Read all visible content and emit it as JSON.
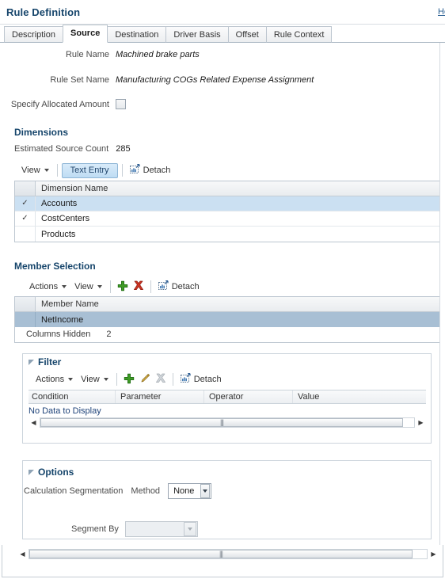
{
  "header": {
    "title": "Rule Definition",
    "help_link": "Help"
  },
  "tabs": [
    {
      "label": "Description",
      "active": false
    },
    {
      "label": "Source",
      "active": true
    },
    {
      "label": "Destination",
      "active": false
    },
    {
      "label": "Driver Basis",
      "active": false
    },
    {
      "label": "Offset",
      "active": false
    },
    {
      "label": "Rule Context",
      "active": false
    }
  ],
  "form": {
    "rule_name_label": "Rule Name",
    "rule_name_value": "Machined brake parts",
    "rule_set_name_label": "Rule Set Name",
    "rule_set_name_value": "Manufacturing COGs Related Expense Assignment",
    "specify_allocated_amount_label": "Specify Allocated Amount",
    "specify_allocated_amount_checked": false
  },
  "dimensions": {
    "section_title": "Dimensions",
    "estimated_source_count_label": "Estimated Source Count",
    "estimated_source_count_value": "285",
    "toolbar": {
      "view_label": "View",
      "text_entry_label": "Text Entry",
      "detach_label": "Detach"
    },
    "columns": [
      "Dimension Name"
    ],
    "rows": [
      {
        "checked": true,
        "name": "Accounts",
        "selected": "light"
      },
      {
        "checked": true,
        "name": "CostCenters",
        "selected": "none"
      },
      {
        "checked": false,
        "name": "Products",
        "selected": "none"
      }
    ]
  },
  "member_selection": {
    "section_title": "Member Selection",
    "toolbar": {
      "actions_label": "Actions",
      "view_label": "View",
      "add_icon": "plus-icon",
      "delete_icon": "delete-x-icon",
      "detach_label": "Detach"
    },
    "columns": [
      "Member Name"
    ],
    "rows": [
      {
        "name": "NetIncome",
        "selected": "dark"
      }
    ],
    "columns_hidden_label": "Columns Hidden",
    "columns_hidden_value": "2"
  },
  "filter": {
    "panel_title": "Filter",
    "toolbar": {
      "actions_label": "Actions",
      "view_label": "View",
      "add_icon": "plus-icon",
      "edit_icon": "pencil-icon",
      "delete_icon": "delete-x-icon-disabled",
      "detach_label": "Detach"
    },
    "columns": [
      "Condition",
      "Parameter",
      "Operator",
      "Value"
    ],
    "empty_message": "No Data to Display"
  },
  "options": {
    "panel_title": "Options",
    "calc_segmentation_label": "Calculation Segmentation",
    "method_label": "Method",
    "method_value": "None",
    "segment_by_label": "Segment By",
    "segment_by_value": "",
    "segment_by_disabled": true
  },
  "colors": {
    "heading": "#16456b",
    "selection_light": "#cbe0f2",
    "selection_dark": "#a8bfd4",
    "toggle_active": "#bedcf3",
    "add_green": "#3f9b26",
    "delete_red": "#cc3322",
    "edit_yellow": "#d8ab2f",
    "link_blue": "#2a5f92"
  }
}
